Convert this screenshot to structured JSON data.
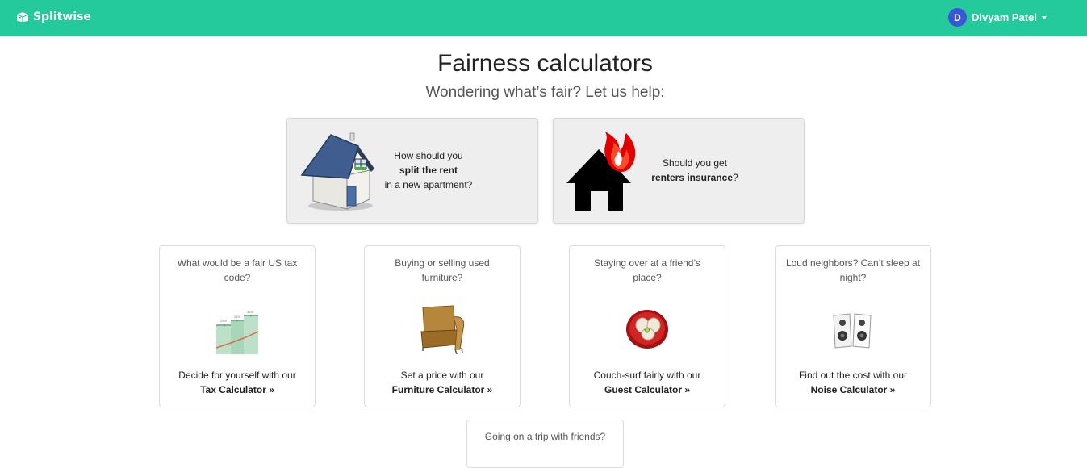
{
  "header": {
    "brand": "Splitwise",
    "user_initial": "D",
    "user_name": "Divyam Patel"
  },
  "main": {
    "title": "Fairness calculators",
    "subtitle": "Wondering what’s fair? Let us help:"
  },
  "featured": [
    {
      "line1": "How should you",
      "bold": "split the rent",
      "line3": "in a new apartment?",
      "icon": "house-icon"
    },
    {
      "line1": "Should you get",
      "bold": "renters insurance",
      "suffix": "?",
      "icon": "burning-house-icon"
    }
  ],
  "calculators": [
    {
      "question": "What would be a fair US tax code?",
      "cta": "Decide for yourself with our",
      "link": "Tax Calculator »",
      "icon": "tax-chart-icon"
    },
    {
      "question": "Buying or selling used furniture?",
      "cta": "Set a price with our",
      "link": "Furniture Calculator »",
      "icon": "armchair-icon"
    },
    {
      "question": "Staying over at a friend’s place?",
      "cta": "Couch-surf fairly with our",
      "link": "Guest Calculator »",
      "icon": "guest-plate-icon"
    },
    {
      "question": "Loud neighbors? Can’t sleep at night?",
      "cta": "Find out the cost with our",
      "link": "Noise Calculator »",
      "icon": "speakers-icon"
    }
  ],
  "trip": {
    "question": "Going on a trip with friends?"
  },
  "colors": {
    "header": "#24c99c",
    "avatar": "#3a55d9",
    "card_bg": "#eeeeee"
  }
}
